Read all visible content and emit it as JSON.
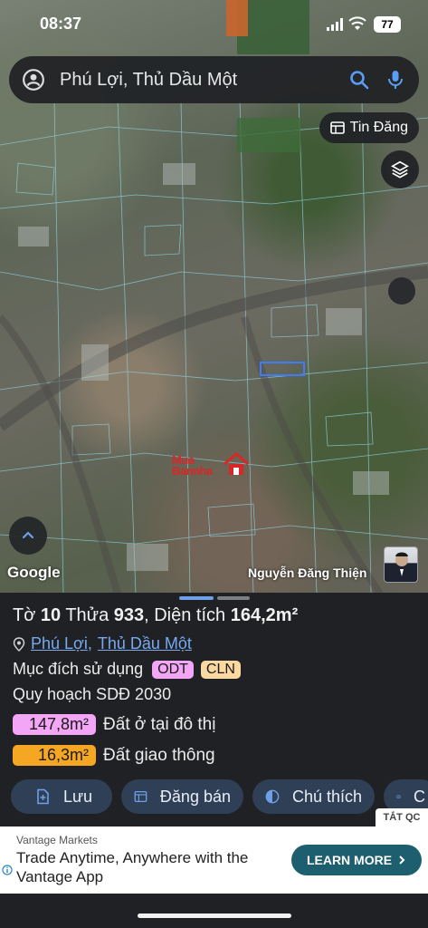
{
  "status_bar": {
    "time": "08:37",
    "battery": "77"
  },
  "search": {
    "query": "Phú Lợi, Thủ Dầu Một"
  },
  "map": {
    "tin_dang_label": "Tin Đăng",
    "google_label": "Google",
    "watermark_line1": "Mua",
    "watermark_line2": "Bannha",
    "agent_name": "Nguyễn Đăng Thiện"
  },
  "parcel": {
    "title_prefix": "Tờ ",
    "sheet_no": "10",
    "title_mid": " Thửa ",
    "plot_no": "933",
    "title_area_label": ", Diện tích ",
    "area": "164,2m²",
    "location_ward": "Phú Lợi",
    "location_city": "Thủ Dầu Một",
    "purpose_label": "Mục đích sử dụng",
    "purpose_tags": [
      "ODT",
      "CLN"
    ],
    "plan_label": "Quy hoạch SDĐ 2030",
    "zones": [
      {
        "area": "147,8m²",
        "label": "Đất ở tại đô thị",
        "color": "#f3a6f6"
      },
      {
        "area": "16,3m²",
        "label": "Đất giao thông",
        "color": "#f5a623"
      }
    ]
  },
  "actions": {
    "save": "Lưu",
    "post": "Đăng bán",
    "legend": "Chú thích",
    "photo": "C"
  },
  "ad": {
    "hide_label": "TẮT QC",
    "advertiser": "Vantage Markets",
    "headline": "Trade Anytime, Anywhere with the Vantage App",
    "cta": "LEARN MORE"
  },
  "colors": {
    "accent": "#78a9ee",
    "button_bg": "#2f3f55",
    "panel_bg": "#1f2124",
    "cta_bg": "#1e5f6f"
  }
}
